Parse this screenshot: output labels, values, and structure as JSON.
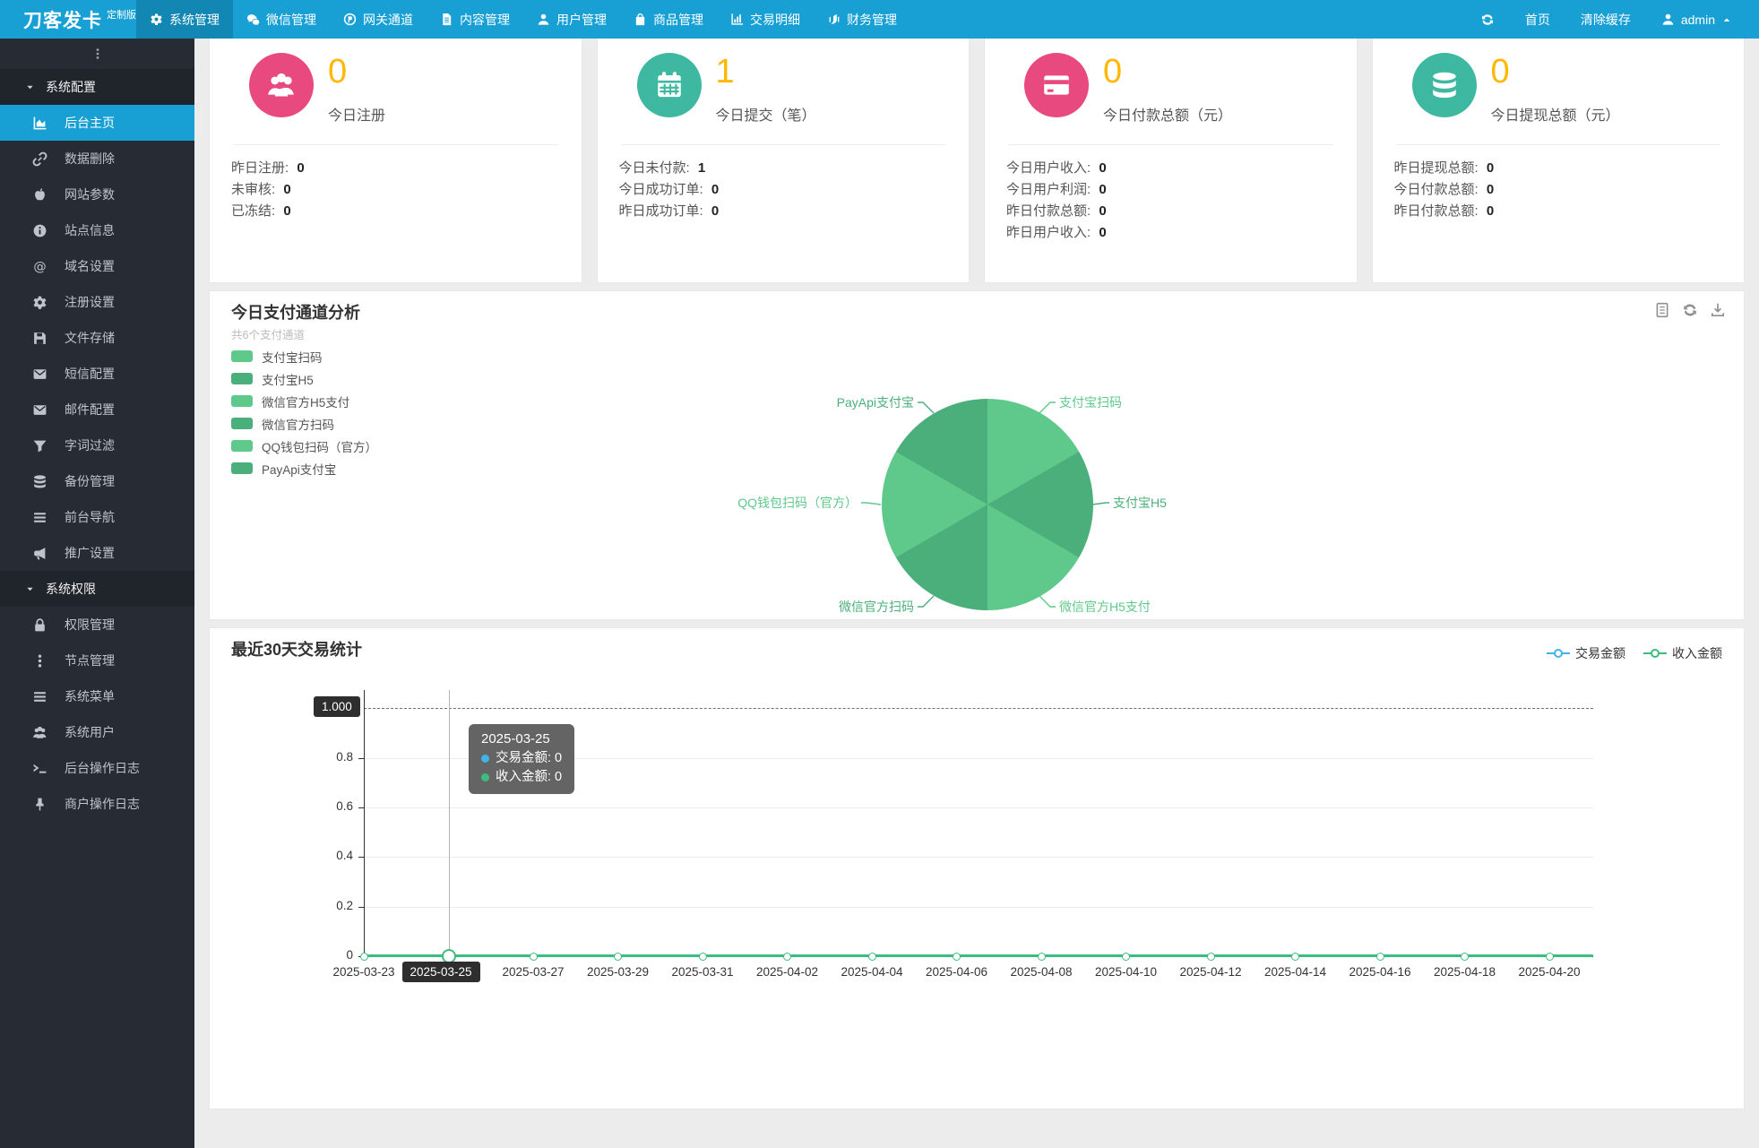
{
  "colors": {
    "navbar": "#18a0d5",
    "nav_active": "#1287b4",
    "sidebar": "#272b33",
    "sidebar_active": "#18a0d5",
    "accent_orange": "#ffb800",
    "card_pink": "#e8497e",
    "card_teal": "#3fb8a1",
    "pie_light": "#5fc98b",
    "pie_dark": "#4baf7b",
    "series_blue": "#41b4e6",
    "series_green": "#3dbd7d"
  },
  "navbar": {
    "logo": "刀客发卡",
    "logo_badge": "定制版",
    "items": [
      {
        "label": "系统管理",
        "icon": "gear-icon",
        "active": true
      },
      {
        "label": "微信管理",
        "icon": "wechat-icon",
        "active": false
      },
      {
        "label": "网关通道",
        "icon": "gateway-icon",
        "active": false
      },
      {
        "label": "内容管理",
        "icon": "document-icon",
        "active": false
      },
      {
        "label": "用户管理",
        "icon": "user-icon",
        "active": false
      },
      {
        "label": "商品管理",
        "icon": "shop-bag-icon",
        "active": false
      },
      {
        "label": "交易明细",
        "icon": "bar-chart-icon",
        "active": false
      },
      {
        "label": "财务管理",
        "icon": "finance-icon",
        "active": false
      }
    ],
    "right": {
      "home": "首页",
      "clear_cache": "清除缓存",
      "username": "admin"
    }
  },
  "sidebar": {
    "sections": [
      {
        "label": "系统配置",
        "items": [
          {
            "label": "后台主页",
            "icon": "chart-area-icon",
            "active": true
          },
          {
            "label": "数据删除",
            "icon": "chain-icon",
            "active": false
          },
          {
            "label": "网站参数",
            "icon": "apple-icon",
            "active": false
          },
          {
            "label": "站点信息",
            "icon": "info-icon",
            "active": false
          },
          {
            "label": "域名设置",
            "icon": "at-icon",
            "active": false
          },
          {
            "label": "注册设置",
            "icon": "gear-icon",
            "active": false
          },
          {
            "label": "文件存储",
            "icon": "floppy-icon",
            "active": false
          },
          {
            "label": "短信配置",
            "icon": "envelope-icon",
            "active": false
          },
          {
            "label": "邮件配置",
            "icon": "envelope-icon",
            "active": false
          },
          {
            "label": "字词过滤",
            "icon": "funnel-icon",
            "active": false
          },
          {
            "label": "备份管理",
            "icon": "database-icon",
            "active": false
          },
          {
            "label": "前台导航",
            "icon": "list-icon",
            "active": false
          },
          {
            "label": "推广设置",
            "icon": "megaphone-icon",
            "active": false
          }
        ]
      },
      {
        "label": "系统权限",
        "items": [
          {
            "label": "权限管理",
            "icon": "lock-icon",
            "active": false
          },
          {
            "label": "节点管理",
            "icon": "dots-vertical-icon",
            "active": false
          },
          {
            "label": "系统菜单",
            "icon": "list-icon",
            "active": false
          },
          {
            "label": "系统用户",
            "icon": "users-group-icon",
            "active": false
          },
          {
            "label": "后台操作日志",
            "icon": "terminal-icon",
            "active": false
          },
          {
            "label": "商户操作日志",
            "icon": "pin-icon",
            "active": false
          }
        ]
      }
    ]
  },
  "stat_cards": [
    {
      "icon": "users-group-icon",
      "icon_color": "#e8497e",
      "value": "0",
      "label": "今日注册",
      "rows": [
        {
          "label": "昨日注册",
          "value": "0"
        },
        {
          "label": "未审核",
          "value": "0"
        },
        {
          "label": "已冻结",
          "value": "0"
        }
      ]
    },
    {
      "icon": "calendar-icon",
      "icon_color": "#3fb8a1",
      "value": "1",
      "label": "今日提交（笔）",
      "rows": [
        {
          "label": "今日未付款",
          "value": "1"
        },
        {
          "label": "今日成功订单",
          "value": "0"
        },
        {
          "label": "昨日成功订单",
          "value": "0"
        }
      ]
    },
    {
      "icon": "credit-card-icon",
      "icon_color": "#e8497e",
      "value": "0",
      "label": "今日付款总额（元）",
      "rows": [
        {
          "label": "今日用户收入",
          "value": "0"
        },
        {
          "label": "今日用户利润",
          "value": "0"
        },
        {
          "label": "昨日付款总额",
          "value": "0"
        },
        {
          "label": "昨日用户收入",
          "value": "0"
        }
      ]
    },
    {
      "icon": "coins-icon",
      "icon_color": "#3fb8a1",
      "value": "0",
      "label": "今日提现总额（元）",
      "rows": [
        {
          "label": "昨日提现总额",
          "value": "0"
        },
        {
          "label": "今日付款总额",
          "value": "0"
        },
        {
          "label": "昨日付款总额",
          "value": "0"
        }
      ]
    }
  ],
  "pie_panel": {
    "title": "今日支付通道分析",
    "subtitle": "共6个支付通道",
    "toolbox": [
      "data-view-icon",
      "refresh-icon",
      "download-icon"
    ],
    "legend": [
      {
        "label": "支付宝扫码",
        "color": "#5fc98b"
      },
      {
        "label": "支付宝H5",
        "color": "#4baf7b"
      },
      {
        "label": "微信官方H5支付",
        "color": "#5fc98b"
      },
      {
        "label": "微信官方扫码",
        "color": "#4baf7b"
      },
      {
        "label": "QQ钱包扫码（官方）",
        "color": "#5fc98b"
      },
      {
        "label": "PayApi支付宝",
        "color": "#4baf7b"
      }
    ]
  },
  "line_panel": {
    "title": "最近30天交易统计",
    "legend": [
      {
        "label": "交易金额",
        "color": "#41b4e6"
      },
      {
        "label": "收入金额",
        "color": "#3dbd7d"
      }
    ],
    "y_ticks": [
      "0",
      "0.2",
      "0.4",
      "0.6",
      "0.8"
    ],
    "y_pointer_label": "1.000",
    "x_pointer_label": "2025-03-25",
    "x_ticks": [
      "2025-03-23",
      "2025-03-25",
      "2025-03-27",
      "2025-03-29",
      "2025-03-31",
      "2025-04-02",
      "2025-04-04",
      "2025-04-06",
      "2025-04-08",
      "2025-04-10",
      "2025-04-12",
      "2025-04-14",
      "2025-04-16",
      "2025-04-18",
      "2025-04-20"
    ],
    "tooltip": {
      "date": "2025-03-25",
      "rows": [
        {
          "label": "交易金额",
          "value": "0",
          "color": "#41b4e6"
        },
        {
          "label": "收入金额",
          "value": "0",
          "color": "#3dbd7d"
        }
      ]
    }
  },
  "chart_data": [
    {
      "type": "pie",
      "title": "今日支付通道分析",
      "subtitle": "共6个支付通道",
      "labels": [
        "支付宝扫码",
        "支付宝H5",
        "微信官方H5支付",
        "微信官方扫码",
        "QQ钱包扫码（官方）",
        "PayApi支付宝"
      ],
      "values": [
        1,
        1,
        1,
        1,
        1,
        1
      ],
      "colors": [
        "#5fc98b",
        "#4baf7b",
        "#5fc98b",
        "#4baf7b",
        "#5fc98b",
        "#4baf7b"
      ],
      "legend_position": "left"
    },
    {
      "type": "line",
      "title": "最近30天交易统计",
      "categories": [
        "2025-03-23",
        "2025-03-25",
        "2025-03-27",
        "2025-03-29",
        "2025-03-31",
        "2025-04-02",
        "2025-04-04",
        "2025-04-06",
        "2025-04-08",
        "2025-04-10",
        "2025-04-12",
        "2025-04-14",
        "2025-04-16",
        "2025-04-18",
        "2025-04-20"
      ],
      "series": [
        {
          "name": "交易金额",
          "color": "#41b4e6",
          "values": [
            0,
            0,
            0,
            0,
            0,
            0,
            0,
            0,
            0,
            0,
            0,
            0,
            0,
            0,
            0
          ]
        },
        {
          "name": "收入金额",
          "color": "#3dbd7d",
          "values": [
            0,
            0,
            0,
            0,
            0,
            0,
            0,
            0,
            0,
            0,
            0,
            0,
            0,
            0,
            0
          ]
        }
      ],
      "ylim": [
        0,
        1
      ],
      "y_ticks": [
        0,
        0.2,
        0.4,
        0.6,
        0.8,
        1.0
      ],
      "grid": true,
      "legend_position": "top-right",
      "active_point": {
        "x": "2025-03-25",
        "values": {
          "交易金额": 0,
          "收入金额": 0
        }
      }
    }
  ]
}
